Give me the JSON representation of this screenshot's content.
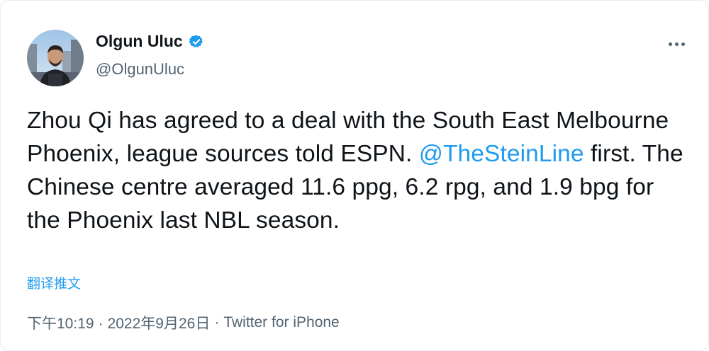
{
  "author": {
    "display_name": "Olgun Uluc",
    "handle": "@OlgunUluc",
    "verified": true
  },
  "tweet": {
    "text_before_mention": "Zhou Qi has agreed to a deal with the South East Melbourne Phoenix, league sources told ESPN. ",
    "mention": "@TheSteinLine",
    "text_after_mention": " first. The Chinese centre averaged 11.6 ppg, 6.2 rpg, and 1.9 bpg for the Phoenix last NBL season."
  },
  "translate_label": "翻译推文",
  "meta": {
    "time": "下午10:19",
    "date": "2022年9月26日",
    "separator": "·",
    "source": "Twitter for iPhone"
  },
  "icons": {
    "verified": "verified-badge-icon",
    "more": "more-options-icon"
  },
  "colors": {
    "accent": "#1d9bf0",
    "text": "#0f1419",
    "secondary": "#536471"
  }
}
